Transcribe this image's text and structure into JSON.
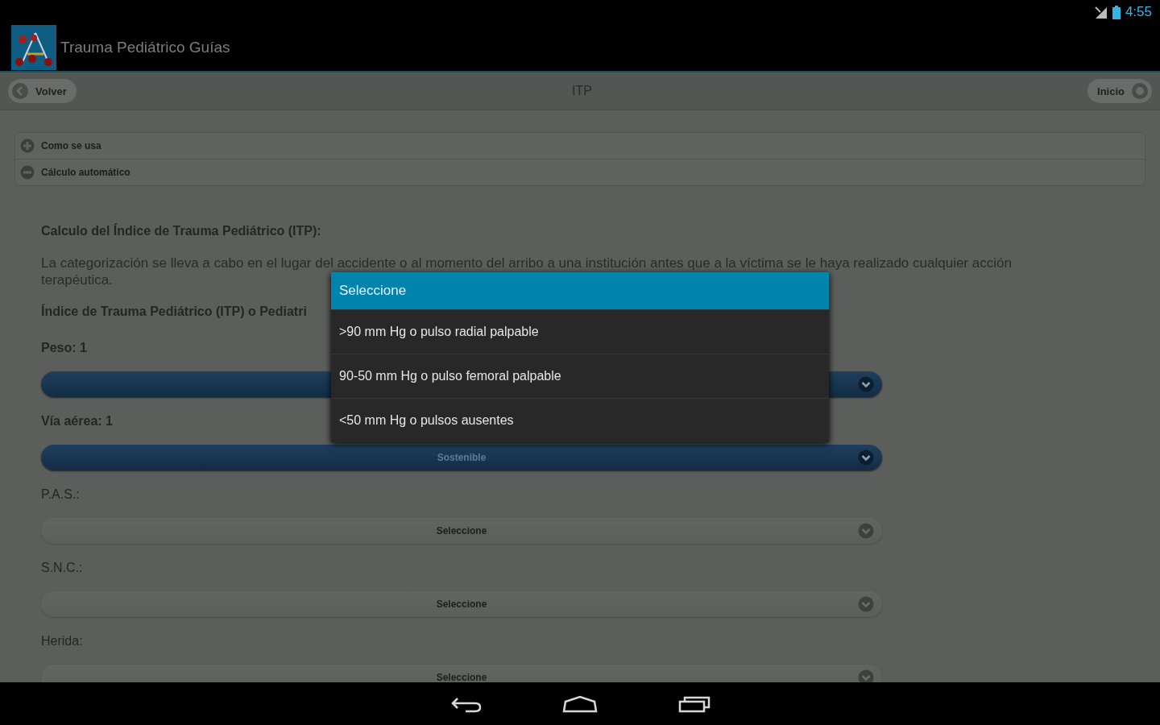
{
  "status_bar": {
    "time": "4:55"
  },
  "action_bar": {
    "title": "Trauma Pediátrico Guías"
  },
  "toolbar": {
    "back_button": "Volver",
    "title": "ITP",
    "home_button": "Inicio"
  },
  "sections": [
    {
      "label": "Como se usa",
      "expanded": false
    },
    {
      "label": "Cálculo automático",
      "expanded": true
    }
  ],
  "content": {
    "heading": "Calculo del Índice de Trauma Pediátrico (ITP):",
    "paragraph": "La categorización se lleva a cabo en el lugar del accidente o al momento del arribo a una institución antes que a la víctima se le haya realizado cualquier acción terapéutica.",
    "subheading": "Índice de Trauma Pediátrico (ITP) o Pediatri"
  },
  "fields": [
    {
      "label": "Peso: 1",
      "kind": "set"
    },
    {
      "label": "Vía aérea: 1",
      "kind": "set",
      "value": "Sostenible"
    },
    {
      "label": "P.A.S.:",
      "kind": "unset",
      "value": "Seleccione"
    },
    {
      "label": "S.N.C.:",
      "kind": "unset",
      "value": "Seleccione"
    },
    {
      "label": "Herida:",
      "kind": "unset",
      "value": "Seleccione"
    }
  ],
  "popup": {
    "title": "Seleccione",
    "options": [
      ">90 mm Hg o pulso radial palpable",
      "90-50 mm Hg o pulso femoral palpable",
      "<50 mm Hg o pulsos ausentes"
    ]
  }
}
